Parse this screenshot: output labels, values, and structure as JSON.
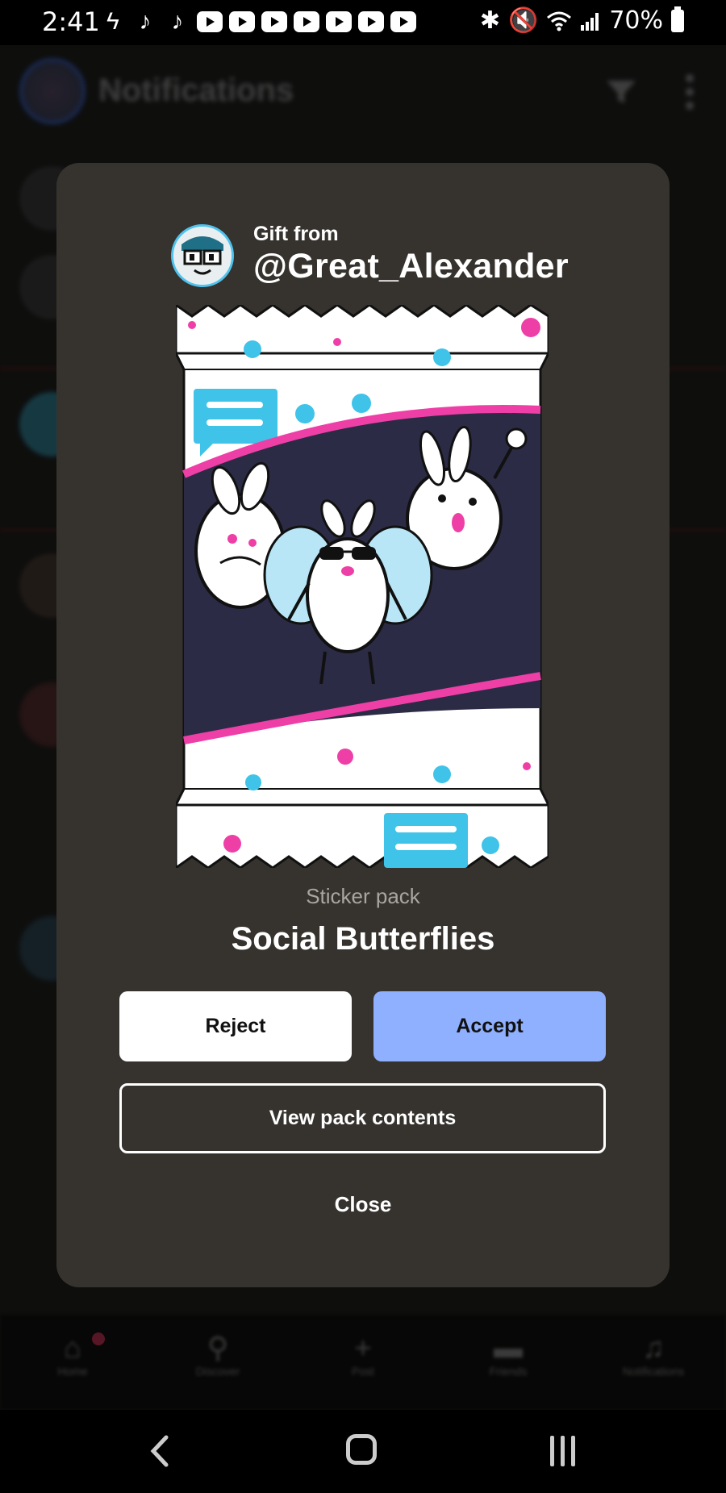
{
  "status_bar": {
    "time": "2:41",
    "battery": "70%",
    "left_icons": [
      "lightning-icon",
      "tiktok-icon",
      "tiktok-icon",
      "youtube-icon",
      "youtube-icon",
      "youtube-icon",
      "youtube-icon",
      "youtube-icon",
      "youtube-icon",
      "youtube-icon"
    ],
    "right_icons": [
      "bluetooth-icon",
      "mute-icon",
      "wifi-icon",
      "signal-icon",
      "battery-icon"
    ]
  },
  "app": {
    "title": "Notifications"
  },
  "bottom_nav": {
    "items": [
      {
        "label": "Home",
        "icon": "home-icon"
      },
      {
        "label": "Discover",
        "icon": "search-icon"
      },
      {
        "label": "Post",
        "icon": "plus-icon"
      },
      {
        "label": "Friends",
        "icon": "chat-icon"
      },
      {
        "label": "Notifications",
        "icon": "bell-icon"
      }
    ]
  },
  "modal": {
    "gift_from_label": "Gift from",
    "gift_user": "@Great_Alexander",
    "pack_type": "Sticker pack",
    "pack_name": "Social Butterflies",
    "reject_label": "Reject",
    "accept_label": "Accept",
    "view_label": "View pack contents",
    "close_label": "Close"
  },
  "colors": {
    "modal_bg": "#36332f",
    "accept_bg": "#8fb0ff",
    "accent_pink": "#ee3fa7",
    "accent_cyan": "#3fc3e8"
  }
}
